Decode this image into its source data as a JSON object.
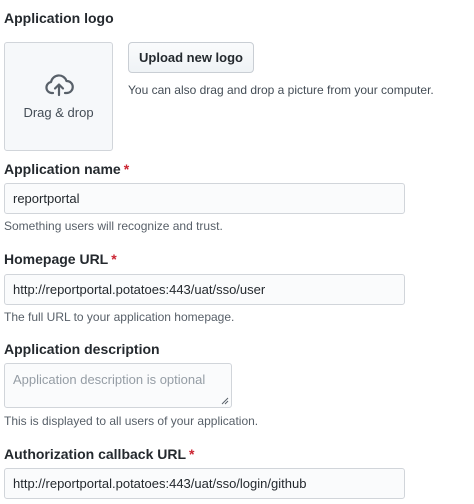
{
  "logo": {
    "heading": "Application logo",
    "dropzone_label": "Drag & drop",
    "dropzone_icon": "cloud-upload-icon",
    "upload_button_label": "Upload new logo",
    "upload_note": "You can also drag and drop a picture from your computer."
  },
  "app_name": {
    "label": "Application name",
    "required_marker": "*",
    "value": "reportportal",
    "note": "Something users will recognize and trust."
  },
  "homepage": {
    "label": "Homepage URL",
    "required_marker": "*",
    "value": "http://reportportal.potatoes:443/uat/sso/user",
    "note": "The full URL to your application homepage."
  },
  "description": {
    "label": "Application description",
    "placeholder": "Application description is optional",
    "value": "",
    "note": "This is displayed to all users of your application."
  },
  "callback": {
    "label": "Authorization callback URL",
    "required_marker": "*",
    "value": "http://reportportal.potatoes:443/uat/sso/login/github"
  },
  "colors": {
    "required": "#cb2431",
    "text": "#24292e",
    "muted": "#586069",
    "border": "#d1d5da",
    "input_bg": "#fafbfc"
  }
}
